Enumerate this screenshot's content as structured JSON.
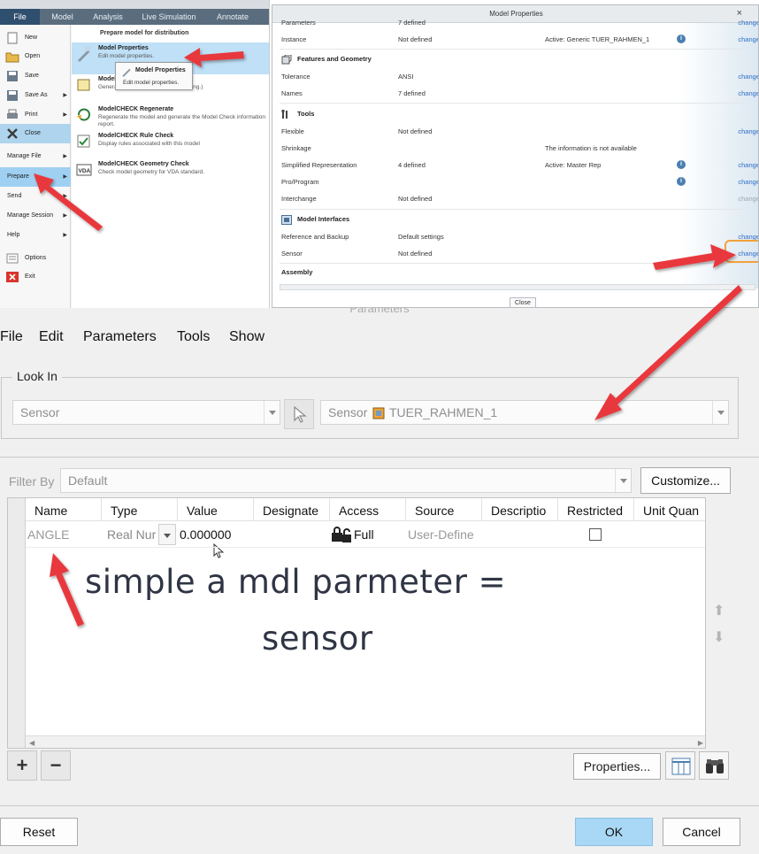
{
  "file_panel": {
    "ribbon_tabs": [
      "File",
      "Model",
      "Analysis",
      "Live Simulation",
      "Annotate"
    ],
    "left_menu": [
      {
        "label": "New"
      },
      {
        "label": "Open"
      },
      {
        "label": "Save"
      },
      {
        "label": "Save As"
      },
      {
        "label": "Print"
      },
      {
        "label": "Close"
      },
      {
        "label": "Manage File"
      },
      {
        "label": "Prepare"
      },
      {
        "label": "Send"
      },
      {
        "label": "Manage Session"
      },
      {
        "label": "Help"
      },
      {
        "label": "Options"
      },
      {
        "label": "Exit"
      }
    ],
    "submenu_title": "Prepare model for distribution",
    "submenu": [
      {
        "title": "Model Properties",
        "desc": "Edit model properties."
      },
      {
        "title": "Model",
        "desc": "Genera                              port (part, assembly, or drawing.)"
      },
      {
        "title": "ModelCHECK Regenerate",
        "desc": "Regenerate the model and generate the Model Check information report."
      },
      {
        "title": "ModelCHECK Rule Check",
        "desc": "Display rules associated with this model"
      },
      {
        "title": "ModelCHECK Geometry Check",
        "desc": "Check model geometry for VDA standard."
      }
    ],
    "tooltip": {
      "title": "Model Properties",
      "desc": "Edit model properties."
    },
    "vda_label": "VDA"
  },
  "model_properties": {
    "title": "Model Properties",
    "close_x": "×",
    "rows_top": [
      {
        "name": "Parameters",
        "value": "7 defined",
        "extra": "",
        "action": "change"
      },
      {
        "name": "Instance",
        "value": "Not defined",
        "extra": "Active: Generic   TUER_RAHMEN_1",
        "action": "change"
      }
    ],
    "sections": [
      {
        "title": "Features and Geometry",
        "rows": [
          {
            "name": "Tolerance",
            "value": "ANSI",
            "extra": "",
            "action": "change"
          },
          {
            "name": "Names",
            "value": "7 defined",
            "extra": "",
            "action": "change"
          }
        ]
      },
      {
        "title": "Tools",
        "rows": [
          {
            "name": "Flexible",
            "value": "Not defined",
            "extra": "",
            "action": "change"
          },
          {
            "name": "Shrinkage",
            "value": "",
            "extra": "The information is not available",
            "action": ""
          },
          {
            "name": "Simplified Representation",
            "value": "4 defined",
            "extra": "Active: Master Rep",
            "action": "change"
          },
          {
            "name": "Pro/Program",
            "value": "",
            "extra": "",
            "action": "change"
          },
          {
            "name": "Interchange",
            "value": "Not defined",
            "extra": "",
            "action": "change"
          }
        ]
      },
      {
        "title": "Model Interfaces",
        "rows": [
          {
            "name": "Reference and Backup",
            "value": "Default settings",
            "extra": "",
            "action": "change"
          },
          {
            "name": "Sensor",
            "value": "Not defined",
            "extra": "",
            "action": "change"
          }
        ]
      },
      {
        "title": "Assembly",
        "rows": []
      }
    ],
    "info_glyph": "i",
    "close_button": "Close"
  },
  "parameters_dialog": {
    "title": "Parameters",
    "menu": [
      "File",
      "Edit",
      "Parameters",
      "Tools",
      "Show"
    ],
    "look_in_label": "Look In",
    "look_in_type": "Sensor",
    "look_in_prefix": "Sensor",
    "look_in_model": "TUER_RAHMEN_1",
    "filter_label": "Filter By",
    "filter_value": "Default",
    "customize_button": "Customize...",
    "columns": [
      "Name",
      "Type",
      "Value",
      "Designate",
      "Access",
      "Source",
      "Descriptio",
      "Restricted",
      "Unit Quan"
    ],
    "rows": [
      {
        "name": "ANGLE",
        "type": "Real Nur",
        "value": "0.000000",
        "designate": "",
        "access": "Full",
        "source": "User-Define",
        "description": "",
        "restricted": false
      }
    ],
    "add_glyph": "+",
    "remove_glyph": "−",
    "properties_button": "Properties...",
    "reset_button": "Reset",
    "ok_button": "OK",
    "cancel_button": "Cancel"
  },
  "annotation": {
    "line1": "simple  a mdl parmeter =",
    "line2": "sensor",
    "arrow_color": "#e8383d"
  },
  "colors": {
    "accent_blue": "#a9d8f6",
    "link_blue": "#2d6ec9",
    "ribbon": "#5a6d7e",
    "highlight_orange": "#f2a23a"
  }
}
